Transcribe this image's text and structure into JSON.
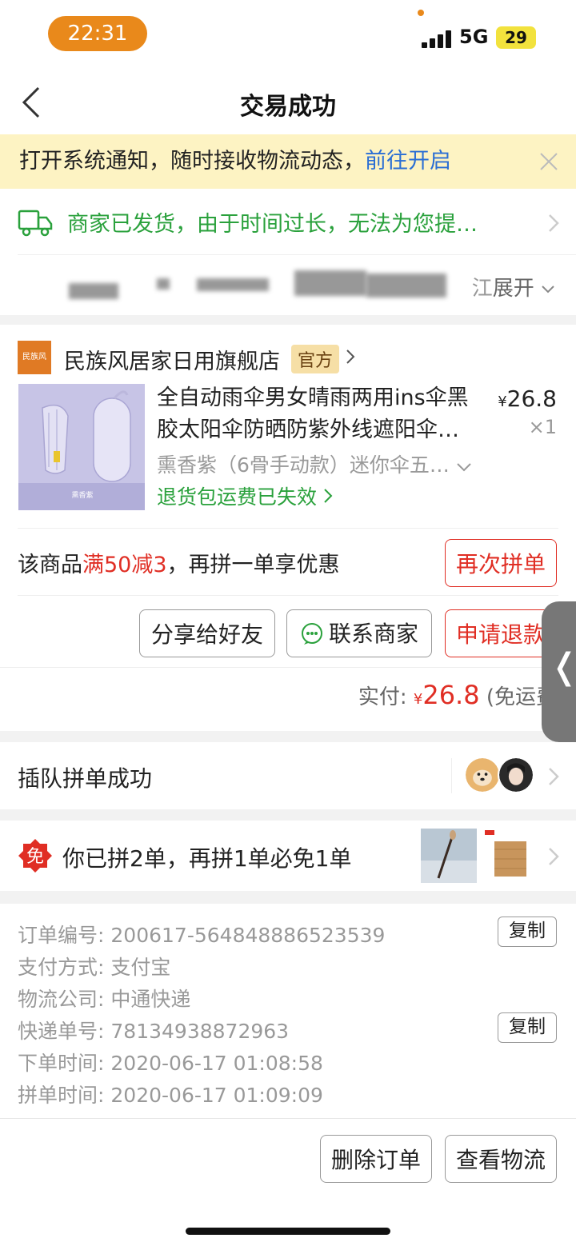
{
  "status_bar": {
    "time": "22:31",
    "network": "5G",
    "battery": "29"
  },
  "nav": {
    "title": "交易成功"
  },
  "notice": {
    "text": "打开系统通知，随时接收物流动态，",
    "link": "前往开启"
  },
  "logistics": {
    "status": "商家已发货，由于时间过长，无法为您提…",
    "address_suffix": "江",
    "expand_label": "展开"
  },
  "shop": {
    "logo_text": "民族风",
    "name": "民族风居家日用旗舰店",
    "badge": "官方"
  },
  "product": {
    "image_caption": "熏香紫",
    "title": "全自动雨伞男女晴雨两用ins伞黑胶太阳伞防晒防紫外线遮阳伞…",
    "currency": "¥",
    "price": "26.8",
    "quantity": "×1",
    "spec": "熏香紫（6骨手动款）迷你伞五…",
    "return_fee_note": "退货包运费已失效"
  },
  "promo": {
    "prefix": "该商品",
    "highlight": "满50减3",
    "suffix": "，再拼一单享优惠",
    "button": "再次拼单"
  },
  "actions": {
    "share": "分享给好友",
    "contact": "联系商家",
    "refund": "申请退款"
  },
  "payment": {
    "label": "实付:",
    "currency": "¥",
    "amount": "26.8",
    "note": "(免运费"
  },
  "queue": {
    "text": "插队拼单成功"
  },
  "free_deal": {
    "badge": "免",
    "text": "你已拼2单，再拼1单必免1单"
  },
  "order_info": {
    "order_no_label": "订单编号:",
    "order_no": "200617-564848886523539",
    "pay_method_label": "支付方式:",
    "pay_method": "支付宝",
    "courier_label": "物流公司:",
    "courier": "中通快递",
    "tracking_label": "快递单号:",
    "tracking_no": "78134938872963",
    "order_time_label": "下单时间:",
    "order_time": "2020-06-17 01:08:58",
    "group_time_label": "拼单时间:",
    "group_time": "2020-06-17 01:09:09",
    "copy_label": "复制"
  },
  "bottom": {
    "delete": "删除订单",
    "track": "查看物流"
  },
  "colors": {
    "accent_red": "#e02e24",
    "green": "#2aa13c",
    "link_blue": "#2a6ed4",
    "notice_bg": "#fdf3c3"
  }
}
